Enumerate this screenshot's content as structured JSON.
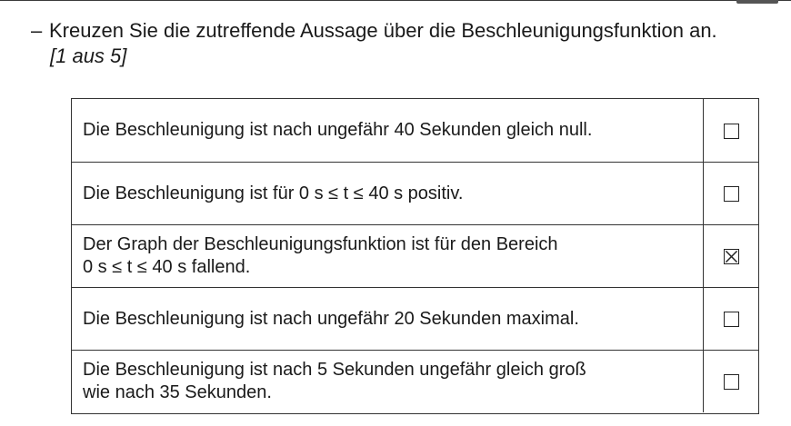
{
  "instruction": {
    "dash": "–",
    "text": "Kreuzen Sie die zutreffende Aussage über die Beschleunigungsfunktion an.",
    "choice_note": "[1 aus 5]"
  },
  "statements": [
    {
      "text": "Die Beschleunigung ist nach ungefähr 40 Sekunden gleich null.",
      "checked": false
    },
    {
      "text": "Die Beschleunigung ist für 0 s ≤ t ≤ 40 s positiv.",
      "checked": false
    },
    {
      "text": "Der Graph der Beschleunigungsfunktion ist für den Bereich\n0 s ≤ t ≤ 40 s fallend.",
      "checked": true
    },
    {
      "text": "Die Beschleunigung ist nach ungefähr 20 Sekunden maximal.",
      "checked": false
    },
    {
      "text": "Die Beschleunigung ist nach 5 Sekunden ungefähr gleich groß\nwie nach 35 Sekunden.",
      "checked": false
    }
  ]
}
